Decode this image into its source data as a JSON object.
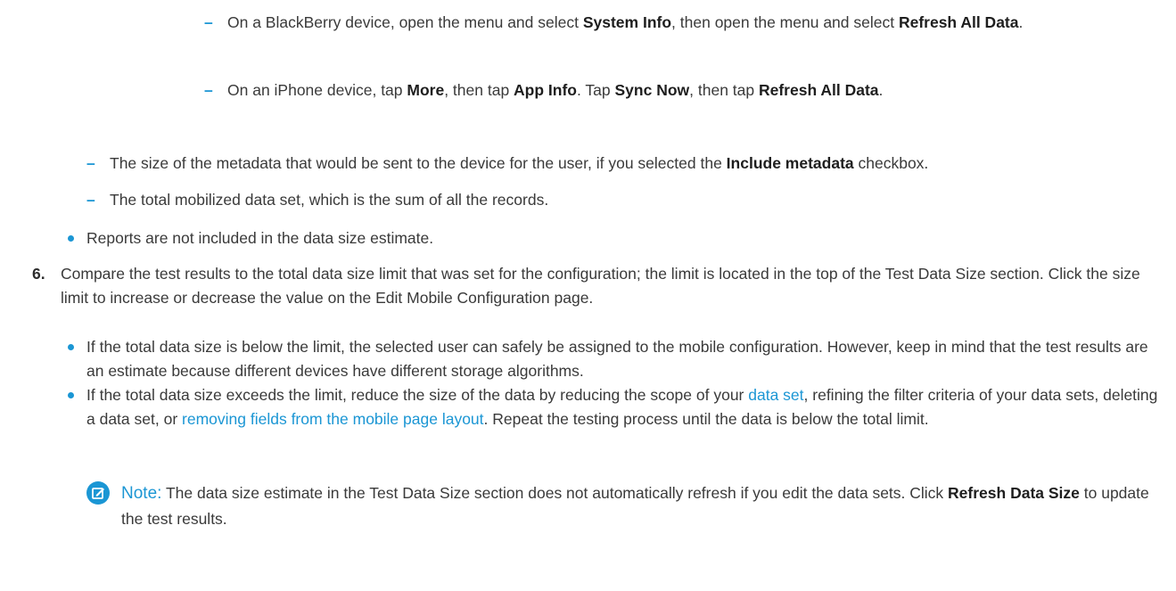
{
  "items": {
    "bb": {
      "t1": "On a BlackBerry device, open the menu and select ",
      "b1": "System Info",
      "t2": ", then open the menu and select ",
      "b2": "Refresh All Data",
      "t3": "."
    },
    "iphone": {
      "t1": "On an iPhone device, tap ",
      "b1": "More",
      "t2": ", then tap ",
      "b2": "App Info",
      "t3": ". Tap ",
      "b3": "Sync Now",
      "t4": ", then tap ",
      "b4": "Refresh All Data",
      "t5": "."
    },
    "metadata": {
      "t1": "The size of the metadata that would be sent to the device for the user, if you selected the ",
      "b1": "Include metadata",
      "t2": " checkbox."
    },
    "total": "The total mobilized data set, which is the sum of all the records.",
    "reports": "Reports are not included in the data size estimate."
  },
  "step6": {
    "number": "6.",
    "text": "Compare the test results to the total data size limit that was set for the configuration; the limit is located in the top of the Test Data Size section. Click the size limit to increase or decrease the value on the Edit Mobile Configuration page.",
    "below": "If the total data size is below the limit, the selected user can safely be assigned to the mobile configuration. However, keep in mind that the test results are an estimate because different devices have different storage algorithms.",
    "exceeds": {
      "t1": "If the total data size exceeds the limit, reduce the size of the data by reducing the scope of your ",
      "link1": "data set",
      "t2": ", refining the filter criteria of your data sets, deleting a data set, or ",
      "link2": "removing fields from the mobile page layout",
      "t3": ". Repeat the testing process until the data is below the total limit."
    }
  },
  "note": {
    "label": "Note:",
    "t1": " The data size estimate in the Test Data Size section does not automatically refresh if you edit the data sets. Click ",
    "b1": "Refresh Data Size",
    "t2": " to update the test results."
  },
  "colors": {
    "accent": "#1b96d4",
    "text": "#3a3a3a"
  },
  "icons": {
    "note": "note-edit-icon"
  }
}
